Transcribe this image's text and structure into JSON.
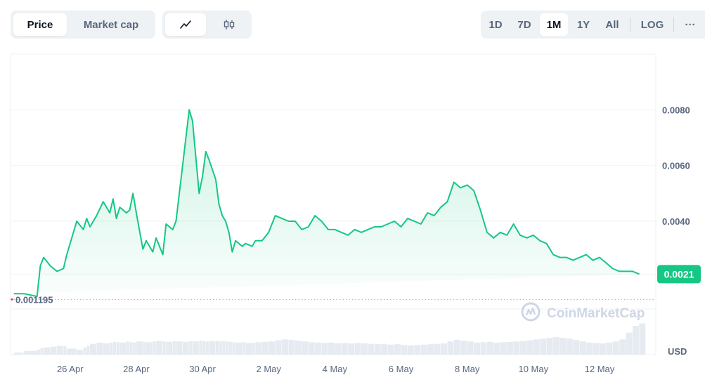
{
  "toolbar": {
    "metric_tabs": [
      {
        "label": "Price",
        "active": true
      },
      {
        "label": "Market cap",
        "active": false
      }
    ],
    "chart_type_icons": [
      "line-chart-icon",
      "candlestick-icon"
    ],
    "ranges": [
      "1D",
      "7D",
      "1M",
      "1Y",
      "All"
    ],
    "active_range": "1M",
    "log_label": "LOG",
    "more_label": "···"
  },
  "watermark": "CoinMarketCap",
  "colors": {
    "line": "#16c784",
    "accent": "#16c784",
    "grid": "#eff2f5"
  },
  "chart_data": {
    "type": "area",
    "y_axis_labels": [
      "0.0080",
      "0.0060",
      "0.0040"
    ],
    "y_ticks": [
      0.008,
      0.006,
      0.004
    ],
    "ylim": [
      0.00085,
      0.01
    ],
    "current_price_label": "0.0021",
    "current_price": 0.0021,
    "low_price_label": "0.001195",
    "low_price": 0.001195,
    "currency_label": "USD",
    "x_tick_labels": [
      "26 Apr",
      "28 Apr",
      "30 Apr",
      "2 May",
      "4 May",
      "6 May",
      "8 May",
      "10 May",
      "12 May"
    ],
    "x_ticks": [
      26,
      28,
      30,
      32,
      34,
      36,
      38,
      40,
      42
    ],
    "xlim": [
      24.2,
      43.7
    ],
    "x": [
      24.3,
      24.6,
      25.0,
      25.1,
      25.2,
      25.4,
      25.6,
      25.8,
      25.9,
      26.2,
      26.4,
      26.5,
      26.6,
      26.8,
      27.0,
      27.2,
      27.3,
      27.4,
      27.5,
      27.7,
      27.8,
      27.9,
      28.0,
      28.2,
      28.3,
      28.5,
      28.6,
      28.8,
      28.9,
      29.1,
      29.2,
      29.4,
      29.6,
      29.7,
      29.9,
      30.0,
      30.1,
      30.2,
      30.4,
      30.5,
      30.6,
      30.7,
      30.8,
      30.9,
      31.0,
      31.2,
      31.3,
      31.5,
      31.6,
      31.8,
      32.0,
      32.2,
      32.4,
      32.6,
      32.8,
      33.0,
      33.2,
      33.4,
      33.6,
      33.8,
      34.0,
      34.2,
      34.4,
      34.6,
      34.8,
      35.0,
      35.2,
      35.4,
      35.6,
      35.8,
      36.0,
      36.2,
      36.4,
      36.6,
      36.8,
      37.0,
      37.2,
      37.4,
      37.6,
      37.8,
      38.0,
      38.2,
      38.4,
      38.6,
      38.8,
      39.0,
      39.2,
      39.4,
      39.6,
      39.8,
      40.0,
      40.2,
      40.4,
      40.6,
      40.8,
      41.0,
      41.2,
      41.4,
      41.6,
      41.8,
      42.0,
      42.2,
      42.4,
      42.6,
      42.8,
      43.0,
      43.2,
      43.4,
      43.6
    ],
    "series": [
      {
        "values": [
          0.0014,
          0.0014,
          0.0013,
          0.0024,
          0.0027,
          0.0024,
          0.0022,
          0.0023,
          0.0028,
          0.004,
          0.0037,
          0.0041,
          0.0038,
          0.0042,
          0.0047,
          0.0043,
          0.0048,
          0.0041,
          0.0045,
          0.0043,
          0.0044,
          0.005,
          0.0043,
          0.003,
          0.0033,
          0.0029,
          0.0034,
          0.0028,
          0.0039,
          0.0037,
          0.004,
          0.006,
          0.008,
          0.0076,
          0.005,
          0.0056,
          0.0065,
          0.0062,
          0.0055,
          0.0046,
          0.0042,
          0.004,
          0.0036,
          0.0029,
          0.0033,
          0.0031,
          0.0032,
          0.0031,
          0.0033,
          0.0033,
          0.0036,
          0.0042,
          0.0041,
          0.004,
          0.004,
          0.0037,
          0.0038,
          0.0042,
          0.004,
          0.0037,
          0.0037,
          0.0036,
          0.0035,
          0.0037,
          0.0036,
          0.0037,
          0.0038,
          0.0038,
          0.0039,
          0.004,
          0.0038,
          0.0041,
          0.004,
          0.0039,
          0.0043,
          0.0042,
          0.0045,
          0.0047,
          0.0054,
          0.0052,
          0.0053,
          0.0051,
          0.0044,
          0.0036,
          0.0034,
          0.0036,
          0.0035,
          0.0039,
          0.0035,
          0.0034,
          0.0035,
          0.0033,
          0.0032,
          0.0028,
          0.0027,
          0.0027,
          0.0026,
          0.0027,
          0.0028,
          0.0026,
          0.0027,
          0.0025,
          0.0023,
          0.0022,
          0.0022,
          0.0022,
          0.0021
        ],
        "volume": [
          0.05,
          0.09,
          0.13,
          0.16,
          0.18,
          0.2,
          0.22,
          0.21,
          0.15,
          0.12,
          0.18,
          0.22,
          0.27,
          0.3,
          0.28,
          0.3,
          0.32,
          0.31,
          0.3,
          0.33,
          0.31,
          0.3,
          0.33,
          0.32,
          0.31,
          0.33,
          0.34,
          0.33,
          0.32,
          0.34,
          0.33,
          0.32,
          0.34,
          0.33,
          0.35,
          0.34,
          0.33,
          0.34,
          0.35,
          0.33,
          0.34,
          0.33,
          0.32,
          0.31,
          0.3,
          0.31,
          0.29,
          0.3,
          0.31,
          0.32,
          0.33,
          0.36,
          0.38,
          0.37,
          0.35,
          0.33,
          0.31,
          0.3,
          0.29,
          0.3,
          0.28,
          0.29,
          0.28,
          0.29,
          0.28,
          0.27,
          0.26,
          0.27,
          0.25,
          0.26,
          0.24,
          0.23,
          0.24,
          0.25,
          0.26,
          0.27,
          0.28,
          0.33,
          0.37,
          0.35,
          0.33,
          0.3,
          0.31,
          0.32,
          0.3,
          0.31,
          0.32,
          0.33,
          0.34,
          0.36,
          0.38,
          0.4,
          0.42,
          0.44,
          0.42,
          0.4,
          0.37,
          0.33,
          0.3,
          0.29,
          0.28,
          0.3,
          0.33,
          0.38,
          0.55,
          0.72,
          0.78
        ]
      }
    ]
  }
}
